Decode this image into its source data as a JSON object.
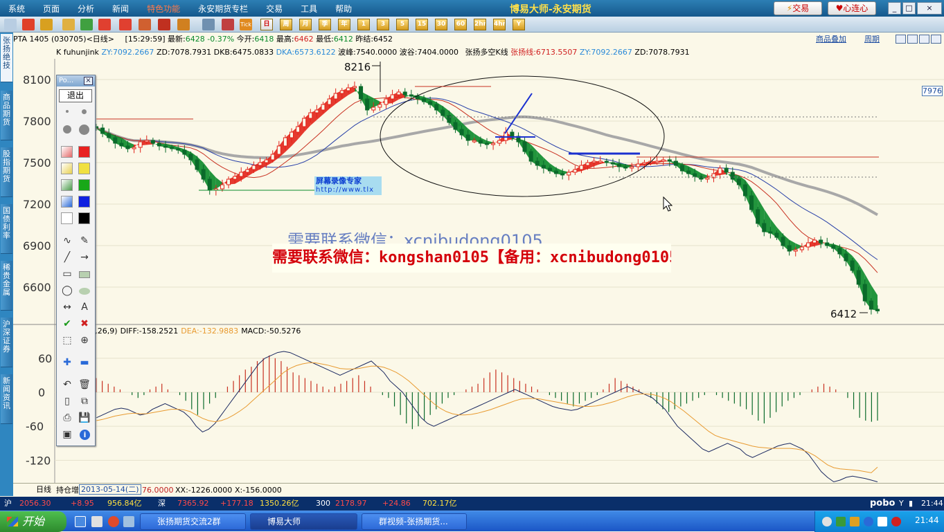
{
  "menu": [
    "系统",
    "页面",
    "分析",
    "新闻",
    "特色功能",
    "永安期货专栏",
    "交易",
    "工具",
    "帮助"
  ],
  "app_title": "博易大师-永安期货",
  "top_buttons": {
    "trade": "交易",
    "heart": "心连心"
  },
  "window_controls": [
    "_",
    "□",
    "×"
  ],
  "period_buttons": [
    "日",
    "周",
    "月",
    "季",
    "年",
    "1",
    "3",
    "5",
    "15",
    "30",
    "60",
    "2hr",
    "4hr",
    "Y"
  ],
  "left_tabs": [
    "张扬绝技",
    "商品期货",
    "股指期货",
    "国债利率",
    "稀贵金属",
    "沪深证券",
    "新闻资讯"
  ],
  "infobar": {
    "symbol": "PTA 1405 (030705)",
    "period": "<日线>",
    "time": "[15:29:59]",
    "latest_label": "最新:",
    "latest": "6428",
    "change": "-0.37%",
    "open_label": "今开:",
    "open": "6418",
    "high_label": "最高:",
    "high": "6462",
    "low_label": "最低:",
    "low": "6412",
    "settle_label": "昨结:",
    "settle": "6452",
    "links": [
      "商品叠加",
      "周期"
    ]
  },
  "indicators": {
    "k": "K  fuhunjink",
    "zy": "ZY:7092.2667",
    "zd": "ZD:7078.7931",
    "dkb": "DKB:6475.0833",
    "dka": "DKA:6573.6122",
    "bofeng": "波峰:7540.0000",
    "bogu": "波谷:7404.0000",
    "zydk": "张扬多空K线",
    "zyx": "张扬线:6713.5507",
    "zy2": "ZY:7092.2667",
    "zd2": "ZD:7078.7931"
  },
  "chart_data": {
    "type": "candlestick",
    "y_ticks": [
      "8100",
      "7800",
      "7500",
      "7200",
      "6900",
      "6600"
    ],
    "macd_ticks": [
      "60",
      "0",
      "-60",
      "-120"
    ],
    "max_label": "8216",
    "min_label": "6412",
    "right_price": "7976",
    "macd_header": {
      "params": "(12,26,9)",
      "diff": "DIFF:-158.2521",
      "dea": "DEA:-132.9883",
      "macd": "MACD:-50.5276"
    },
    "closes": [
      7750,
      7710,
      7680,
      7640,
      7620,
      7600,
      7610,
      7650,
      7660,
      7640,
      7620,
      7610,
      7600,
      7590,
      7560,
      7520,
      7450,
      7380,
      7300,
      7310,
      7340,
      7380,
      7400,
      7430,
      7450,
      7480,
      7500,
      7520,
      7560,
      7620,
      7680,
      7720,
      7760,
      7820,
      7860,
      7880,
      7920,
      7960,
      8000,
      8020,
      8040,
      8050,
      7960,
      7880,
      7900,
      7920,
      7960,
      7990,
      8010,
      7990,
      7980,
      7960,
      7940,
      7920,
      7880,
      7840,
      7790,
      7740,
      7700,
      7660,
      7660,
      7640,
      7630,
      7640,
      7660,
      7720,
      7690,
      7650,
      7580,
      7510,
      7480,
      7460,
      7440,
      7420,
      7410,
      7430,
      7450,
      7480,
      7500,
      7510,
      7510,
      7500,
      7490,
      7470,
      7460,
      7470,
      7490,
      7500,
      7510,
      7510,
      7520,
      7510,
      7480,
      7440,
      7420,
      7400,
      7380,
      7390,
      7420,
      7460,
      7430,
      7380,
      7340,
      7260,
      7160,
      7060,
      7000,
      6990,
      6960,
      6900,
      6860,
      6870,
      6890,
      6920,
      6940,
      6920,
      6900,
      6880,
      6840,
      6790,
      6720,
      6620,
      6500,
      6440,
      6428
    ],
    "macd_bars": [
      25,
      20,
      15,
      10,
      5,
      0,
      -5,
      -10,
      -5,
      5,
      10,
      15,
      5,
      0,
      -5,
      -15,
      -30,
      -40,
      -30,
      -20,
      -10,
      0,
      10,
      20,
      30,
      40,
      45,
      55,
      60,
      65,
      60,
      55,
      45,
      35,
      30,
      25,
      20,
      15,
      10,
      5,
      10,
      15,
      20,
      25,
      30,
      20,
      10,
      0,
      -5,
      -10,
      -25,
      -40,
      -55,
      -65,
      -60,
      -50,
      -40,
      -30,
      -20,
      -10,
      -5,
      0,
      5,
      10,
      15,
      25,
      35,
      40,
      35,
      30,
      25,
      20,
      15,
      10,
      5,
      0,
      -5,
      -10,
      -15,
      -20,
      -25,
      -20,
      -15,
      -10,
      -5,
      5,
      15,
      25,
      20,
      15,
      10,
      5,
      0,
      -10,
      -20,
      -30,
      -35,
      -30,
      -25,
      -20,
      -15,
      -10,
      -5,
      0,
      -5,
      -10,
      -15,
      -20,
      -25,
      -30,
      -40,
      -50,
      -55,
      -45,
      -35,
      -25,
      -15,
      -10,
      -5,
      0,
      5,
      10,
      15,
      10,
      5,
      0,
      -10,
      -30,
      -45,
      -50,
      -52,
      -50
    ],
    "diff_line": [
      -45,
      -40,
      -35,
      -30,
      -28,
      -30,
      -35,
      -40,
      -38,
      -30,
      -25,
      -20,
      -25,
      -30,
      -35,
      -45,
      -60,
      -70,
      -65,
      -55,
      -40,
      -25,
      -10,
      5,
      20,
      35,
      50,
      60,
      65,
      70,
      72,
      70,
      65,
      60,
      55,
      50,
      45,
      40,
      35,
      30,
      35,
      40,
      45,
      50,
      55,
      45,
      35,
      20,
      10,
      0,
      -15,
      -30,
      -45,
      -55,
      -60,
      -55,
      -50,
      -45,
      -40,
      -35,
      -30,
      -25,
      -20,
      -15,
      -10,
      -5,
      0,
      5,
      0,
      -5,
      -10,
      -15,
      -20,
      -25,
      -28,
      -30,
      -32,
      -30,
      -25,
      -20,
      -15,
      -10,
      -5,
      0,
      5,
      10,
      5,
      0,
      -5,
      -10,
      -20,
      -30,
      -45,
      -60,
      -70,
      -80,
      -90,
      -100,
      -105,
      -100,
      -95,
      -90,
      -95,
      -100,
      -110,
      -115,
      -110,
      -105,
      -100,
      -95,
      -92,
      -90,
      -95,
      -100,
      -110,
      -125,
      -140,
      -150,
      -158,
      -155,
      -150,
      -148,
      -150,
      -152,
      -155,
      -158
    ],
    "dea_line": [
      -50,
      -48,
      -45,
      -42,
      -40,
      -38,
      -37,
      -38,
      -38,
      -36,
      -34,
      -32,
      -30,
      -30,
      -31,
      -34,
      -40,
      -46,
      -50,
      -52,
      -50,
      -46,
      -40,
      -33,
      -25,
      -15,
      -5,
      5,
      15,
      25,
      35,
      42,
      47,
      50,
      52,
      52,
      50,
      48,
      45,
      42,
      41,
      41,
      42,
      44,
      46,
      46,
      44,
      40,
      35,
      28,
      20,
      10,
      0,
      -10,
      -20,
      -28,
      -34,
      -38,
      -40,
      -40,
      -39,
      -37,
      -34,
      -31,
      -27,
      -23,
      -19,
      -15,
      -12,
      -11,
      -11,
      -12,
      -14,
      -16,
      -18,
      -20,
      -22,
      -24,
      -25,
      -25,
      -24,
      -22,
      -19,
      -16,
      -12,
      -8,
      -5,
      -3,
      -3,
      -4,
      -7,
      -11,
      -17,
      -25,
      -33,
      -42,
      -51,
      -60,
      -69,
      -76,
      -80,
      -83,
      -86,
      -89,
      -92,
      -95,
      -97,
      -98,
      -99,
      -99,
      -99,
      -99,
      -100,
      -102,
      -106,
      -112,
      -120,
      -128,
      -133,
      -135,
      -136,
      -137,
      -138,
      -140,
      -142,
      -132
    ]
  },
  "palette": {
    "title": "Po...",
    "exit_label": "退出"
  },
  "watermark": {
    "ghost": "需要联系微信：xcnibudong0105",
    "banner": "需要联系微信：kongshan0105【备用：xcnibudong0105】"
  },
  "rec_label": {
    "line1": "屏幕录像专家",
    "line2": "http://www.tlx"
  },
  "bottombar": {
    "period": "日线",
    "holding": "持仓增",
    "date": "2013-05-14(二)",
    "val": "76.0000",
    "xx": "XX:-1226.0000",
    "x": "X:-156.0000"
  },
  "index_bar": [
    {
      "name": "沪",
      "value": "2056.30",
      "change": "+8.95",
      "amount": "956.84亿"
    },
    {
      "name": "深",
      "value": "7365.92",
      "change": "+177.18",
      "amount": "1350.26亿"
    },
    {
      "name": "300",
      "value": "2178.97",
      "change": "+24.86",
      "amount": "702.17亿"
    }
  ],
  "idx_brand": "pobo",
  "idx_time": "21:44",
  "taskbar": {
    "start": "开始",
    "tasks": [
      "张扬期货交流2群",
      "博易大师",
      "群视频-张扬期货..."
    ],
    "clock": "21:44"
  },
  "colors": {
    "up": "#e2231a",
    "down": "#0a8a2a",
    "menu_bg": "#14588c",
    "title": "#ffe04a"
  }
}
